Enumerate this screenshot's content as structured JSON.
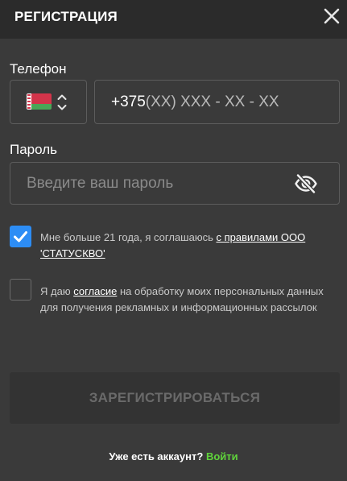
{
  "header": {
    "title": "РЕГИСТРАЦИЯ",
    "close_icon": "close-icon"
  },
  "phone": {
    "label": "Телефон",
    "country_flag": "belarus-flag-icon",
    "country_chevron_icon": "up-down-chevron-icon",
    "prefix": "+375",
    "mask": "(XX) XXX - XX - XX"
  },
  "password": {
    "label": "Пароль",
    "placeholder": "Введите ваш пароль",
    "toggle_icon": "eye-slash-icon"
  },
  "consent_age": {
    "checked": true,
    "text_before": "Мне больше 21 года, я соглашаюсь ",
    "link": "с правилами ООО 'СТАТУСКВО'"
  },
  "consent_data": {
    "checked": false,
    "text_before": "Я даю ",
    "link": "согласие",
    "text_after": " на обработку моих персональных данных для получения рекламных и информационных рассылок"
  },
  "submit": {
    "label": "ЗАРЕГИСТРИРОВАТЬСЯ",
    "disabled": true
  },
  "footer": {
    "question": "Уже есть аккаунт?",
    "login_link": "Войти"
  },
  "colors": {
    "background": "#3a3a3a",
    "header_background": "#2b2b2b",
    "checkbox_accent": "#2d8df5",
    "login_link": "#5fd33b",
    "submit_disabled_bg": "#333333",
    "submit_disabled_text": "#6a6a6a"
  }
}
